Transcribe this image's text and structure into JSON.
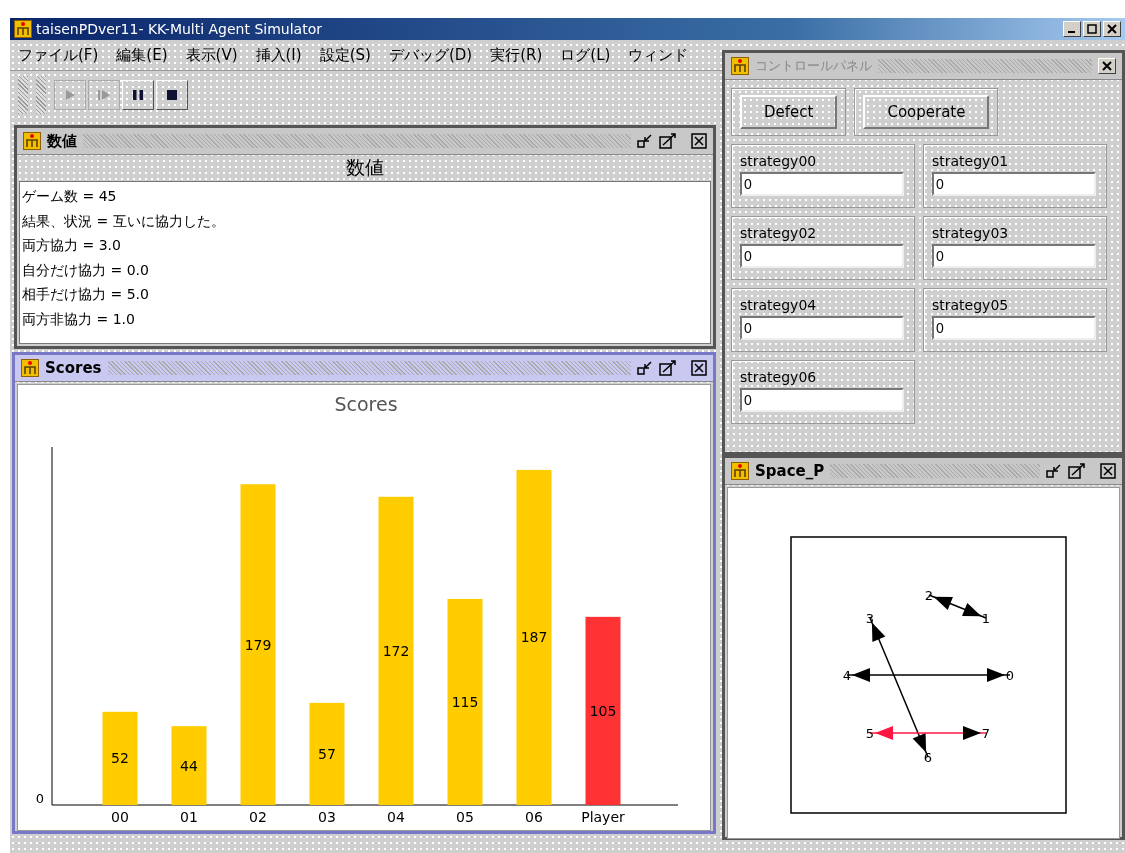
{
  "window": {
    "title": "taisenPDver11- KK-Multi Agent Simulator"
  },
  "menu": [
    "ファイル(F)",
    "編集(E)",
    "表示(V)",
    "挿入(I)",
    "設定(S)",
    "デバッグ(D)",
    "実行(R)",
    "ログ(L)",
    "ウィンド"
  ],
  "toolbar": [
    {
      "kind": "play",
      "disabled": true
    },
    {
      "kind": "step",
      "disabled": true
    },
    {
      "kind": "pause",
      "disabled": false
    },
    {
      "kind": "stop",
      "disabled": false
    }
  ],
  "values_frame": {
    "title": "数値",
    "active": false,
    "heading": "数値",
    "lines": [
      "ゲーム数 = 45",
      "結果、状況 = 互いに協力した。",
      "両方協力 = 3.0",
      "自分だけ協力 = 0.0",
      "相手だけ協力 = 5.0",
      "両方非協力 = 1.0"
    ]
  },
  "scores_frame": {
    "title": "Scores",
    "active": true,
    "chart_data": {
      "type": "bar",
      "title": "Scores",
      "categories": [
        "00",
        "01",
        "02",
        "03",
        "04",
        "05",
        "06",
        "Player"
      ],
      "data_labels": true,
      "annotations": [
        {
          "text": "0"
        }
      ],
      "series": [
        {
          "color": "#ffcc00",
          "values": [
            52,
            44,
            179,
            57,
            172,
            115,
            187,
            null
          ]
        },
        {
          "color": "#ff3333",
          "values": [
            null,
            null,
            null,
            null,
            null,
            null,
            null,
            105
          ]
        }
      ]
    }
  },
  "control_panel": {
    "title": "コントロールパネル",
    "active": false,
    "buttons": [
      "Defect",
      "Cooperate"
    ],
    "fields": [
      {
        "label": "strategy00",
        "value": "0"
      },
      {
        "label": "strategy01",
        "value": "0"
      },
      {
        "label": "strategy02",
        "value": "0"
      },
      {
        "label": "strategy03",
        "value": "0"
      },
      {
        "label": "strategy04",
        "value": "0"
      },
      {
        "label": "strategy05",
        "value": "0"
      },
      {
        "label": "strategy06",
        "value": "0"
      }
    ]
  },
  "space_frame": {
    "title": "Space_P",
    "active": false,
    "edges": [
      {
        "ends": [
          "2",
          "1"
        ],
        "color": "#000000"
      },
      {
        "ends": [
          "3",
          "6"
        ],
        "color": "#000000"
      },
      {
        "ends": [
          "4",
          "0"
        ],
        "color": "#000000"
      },
      {
        "ends": [
          "5",
          "7"
        ],
        "color": "#ff1744"
      }
    ]
  }
}
